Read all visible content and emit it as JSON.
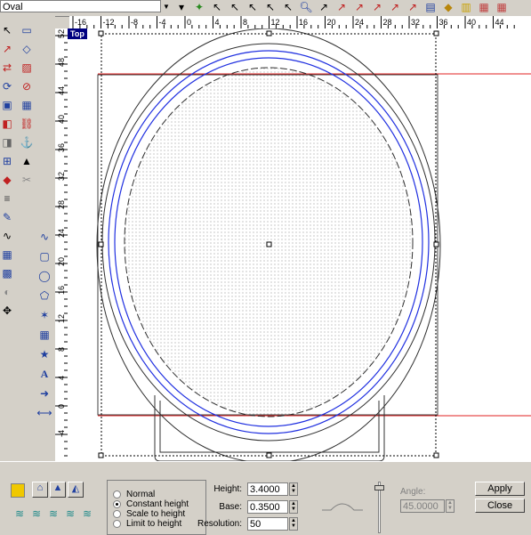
{
  "toolbar": {
    "selected_shape": "Oval",
    "tools": [
      "wand-icon",
      "select-arrow-icon",
      "select-arrow-icon",
      "select-arrow-icon",
      "select-arrow-icon",
      "zoom-icon",
      "select-arrow-icon",
      "node-arrow-icon",
      "node-arrow-icon",
      "node-arrow-icon",
      "layer-icon",
      "paint-icon",
      "bars-icon",
      "texture-icon",
      "texture-icon"
    ]
  },
  "viewport": {
    "label": "Top"
  },
  "rulers": {
    "horizontal": [
      "-16",
      "-12",
      "-8",
      "-4",
      "0",
      "4",
      "8",
      "12",
      "16",
      "20",
      "24",
      "28",
      "32",
      "36",
      "40",
      "44"
    ],
    "vertical": [
      "52",
      "48",
      "44",
      "40",
      "36",
      "32",
      "28",
      "24",
      "20",
      "16",
      "12",
      "8",
      "4",
      "0",
      "-4"
    ]
  },
  "options": {
    "height_mode": [
      "Normal",
      "Constant height",
      "Scale to height",
      "Limit to height"
    ],
    "selected_mode": "Constant height",
    "height_label": "Height:",
    "height_value": "3.4000",
    "base_label": "Base:",
    "base_value": "0.3500",
    "resolution_label": "Resolution:",
    "resolution_value": "50",
    "angle_label": "Angle:",
    "angle_value": "45.0000",
    "apply_label": "Apply",
    "close_label": "Close"
  },
  "colors": {
    "swatch": "#f0c800",
    "accent_line": "#e02020",
    "outline_blue": "#2030e0"
  }
}
